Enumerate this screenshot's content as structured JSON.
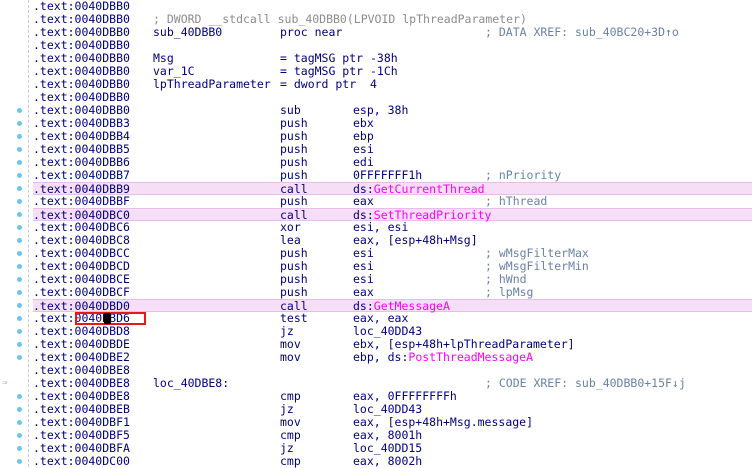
{
  "colors": {
    "background": "#ffffff",
    "text": "#000080",
    "import_name": "#ff00ff",
    "comment": "#6a82a8",
    "highlight_row": "#f7def7",
    "cursor_box": "#e81818",
    "gutter_dot": "#6cc6ea"
  },
  "gutter": {
    "xref_arrow_icon": "⇒"
  },
  "cursor": {
    "address": ".text:0040DBD6"
  },
  "rows": [
    {
      "addr": ".text:0040DBB0",
      "label": "",
      "mnem": "",
      "ops": [],
      "cmt": "",
      "hl": false
    },
    {
      "addr": ".text:0040DBB0",
      "fullcmt": "; DWORD __stdcall sub_40DBB0(LPVOID lpThreadParameter)",
      "hl": false
    },
    {
      "addr": ".text:0040DBB0",
      "label": "sub_40DBB0",
      "mnem": "proc near",
      "ops": [],
      "cmt": "; DATA XREF: sub_40BC20+3D↑o",
      "hl": false
    },
    {
      "addr": ".text:0040DBB0",
      "label": "",
      "mnem": "",
      "ops": [],
      "cmt": "",
      "hl": false
    },
    {
      "addr": ".text:0040DBB0",
      "label": "Msg",
      "mnem": "= tagMSG ptr -38h",
      "ops": [],
      "cmt": "",
      "hl": false
    },
    {
      "addr": ".text:0040DBB0",
      "label": "var_1C",
      "mnem": "= tagMSG ptr -1Ch",
      "ops": [],
      "cmt": "",
      "hl": false
    },
    {
      "addr": ".text:0040DBB0",
      "label": "lpThreadParameter",
      "mnem": "= dword ptr  4",
      "ops": [],
      "cmt": "",
      "hl": false,
      "wide": true
    },
    {
      "addr": ".text:0040DBB0",
      "label": "",
      "mnem": "",
      "ops": [],
      "cmt": "",
      "hl": false
    },
    {
      "addr": ".text:0040DBB0",
      "label": "",
      "mnem": "sub",
      "ops": [
        {
          "t": "esp, 38h"
        }
      ],
      "cmt": "",
      "hl": false
    },
    {
      "addr": ".text:0040DBB3",
      "label": "",
      "mnem": "push",
      "ops": [
        {
          "t": "ebx"
        }
      ],
      "cmt": "",
      "hl": false
    },
    {
      "addr": ".text:0040DBB4",
      "label": "",
      "mnem": "push",
      "ops": [
        {
          "t": "ebp"
        }
      ],
      "cmt": "",
      "hl": false
    },
    {
      "addr": ".text:0040DBB5",
      "label": "",
      "mnem": "push",
      "ops": [
        {
          "t": "esi"
        }
      ],
      "cmt": "",
      "hl": false
    },
    {
      "addr": ".text:0040DBB6",
      "label": "",
      "mnem": "push",
      "ops": [
        {
          "t": "edi"
        }
      ],
      "cmt": "",
      "hl": false
    },
    {
      "addr": ".text:0040DBB7",
      "label": "",
      "mnem": "push",
      "ops": [
        {
          "t": "0FFFFFFF1h"
        }
      ],
      "cmt": "; nPriority",
      "hl": false
    },
    {
      "addr": ".text:0040DBB9",
      "label": "",
      "mnem": "call",
      "ops": [
        {
          "t": "ds:"
        },
        {
          "t": "GetCurrentThread",
          "fn": true
        }
      ],
      "cmt": "",
      "hl": true
    },
    {
      "addr": ".text:0040DBBF",
      "label": "",
      "mnem": "push",
      "ops": [
        {
          "t": "eax"
        }
      ],
      "cmt": "; hThread",
      "hl": false
    },
    {
      "addr": ".text:0040DBC0",
      "label": "",
      "mnem": "call",
      "ops": [
        {
          "t": "ds:"
        },
        {
          "t": "SetThreadPriority",
          "fn": true
        }
      ],
      "cmt": "",
      "hl": true
    },
    {
      "addr": ".text:0040DBC6",
      "label": "",
      "mnem": "xor",
      "ops": [
        {
          "t": "esi, esi"
        }
      ],
      "cmt": "",
      "hl": false
    },
    {
      "addr": ".text:0040DBC8",
      "label": "",
      "mnem": "lea",
      "ops": [
        {
          "t": "eax, [esp+48h+Msg]"
        }
      ],
      "cmt": "",
      "hl": false
    },
    {
      "addr": ".text:0040DBCC",
      "label": "",
      "mnem": "push",
      "ops": [
        {
          "t": "esi"
        }
      ],
      "cmt": "; wMsgFilterMax",
      "hl": false
    },
    {
      "addr": ".text:0040DBCD",
      "label": "",
      "mnem": "push",
      "ops": [
        {
          "t": "esi"
        }
      ],
      "cmt": "; wMsgFilterMin",
      "hl": false
    },
    {
      "addr": ".text:0040DBCE",
      "label": "",
      "mnem": "push",
      "ops": [
        {
          "t": "esi"
        }
      ],
      "cmt": "; hWnd",
      "hl": false
    },
    {
      "addr": ".text:0040DBCF",
      "label": "",
      "mnem": "push",
      "ops": [
        {
          "t": "eax"
        }
      ],
      "cmt": "; lpMsg",
      "hl": false
    },
    {
      "addr": ".text:0040DBD0",
      "label": "",
      "mnem": "call",
      "ops": [
        {
          "t": "ds:"
        },
        {
          "t": "GetMessageA",
          "fn": true
        }
      ],
      "cmt": "",
      "hl": true
    },
    {
      "addr": ".text:0040DBD6",
      "label": "",
      "mnem": "test",
      "ops": [
        {
          "t": "eax, eax"
        }
      ],
      "cmt": "",
      "hl": false,
      "cursor": true
    },
    {
      "addr": ".text:0040DBD8",
      "label": "",
      "mnem": "jz",
      "ops": [
        {
          "t": "loc_40DD43"
        }
      ],
      "cmt": "",
      "hl": false
    },
    {
      "addr": ".text:0040DBDE",
      "label": "",
      "mnem": "mov",
      "ops": [
        {
          "t": "ebx, [esp+48h+lpThreadParameter]"
        }
      ],
      "cmt": "",
      "hl": false
    },
    {
      "addr": ".text:0040DBE2",
      "label": "",
      "mnem": "mov",
      "ops": [
        {
          "t": "ebp, ds:"
        },
        {
          "t": "PostThreadMessageA",
          "fn": true
        }
      ],
      "cmt": "",
      "hl": false
    },
    {
      "addr": ".text:0040DBE8",
      "label": "",
      "mnem": "",
      "ops": [],
      "cmt": "",
      "hl": false
    },
    {
      "addr": ".text:0040DBE8",
      "label": "loc_40DBE8:",
      "mnem": "",
      "ops": [],
      "cmt": "; CODE XREF: sub_40DBB0+15F↓j",
      "hl": false
    },
    {
      "addr": ".text:0040DBE8",
      "label": "",
      "mnem": "cmp",
      "ops": [
        {
          "t": "eax, 0FFFFFFFFh"
        }
      ],
      "cmt": "",
      "hl": false
    },
    {
      "addr": ".text:0040DBEB",
      "label": "",
      "mnem": "jz",
      "ops": [
        {
          "t": "loc_40DD43"
        }
      ],
      "cmt": "",
      "hl": false
    },
    {
      "addr": ".text:0040DBF1",
      "label": "",
      "mnem": "mov",
      "ops": [
        {
          "t": "eax, [esp+48h+Msg.message]"
        }
      ],
      "cmt": "",
      "hl": false
    },
    {
      "addr": ".text:0040DBF5",
      "label": "",
      "mnem": "cmp",
      "ops": [
        {
          "t": "eax, 8001h"
        }
      ],
      "cmt": "",
      "hl": false
    },
    {
      "addr": ".text:0040DBFA",
      "label": "",
      "mnem": "jz",
      "ops": [
        {
          "t": "loc_40DD15"
        }
      ],
      "cmt": "",
      "hl": false
    },
    {
      "addr": ".text:0040DC00",
      "label": "",
      "mnem": "cmp",
      "ops": [
        {
          "t": "eax, 8002h"
        }
      ],
      "cmt": "",
      "hl": false
    }
  ]
}
